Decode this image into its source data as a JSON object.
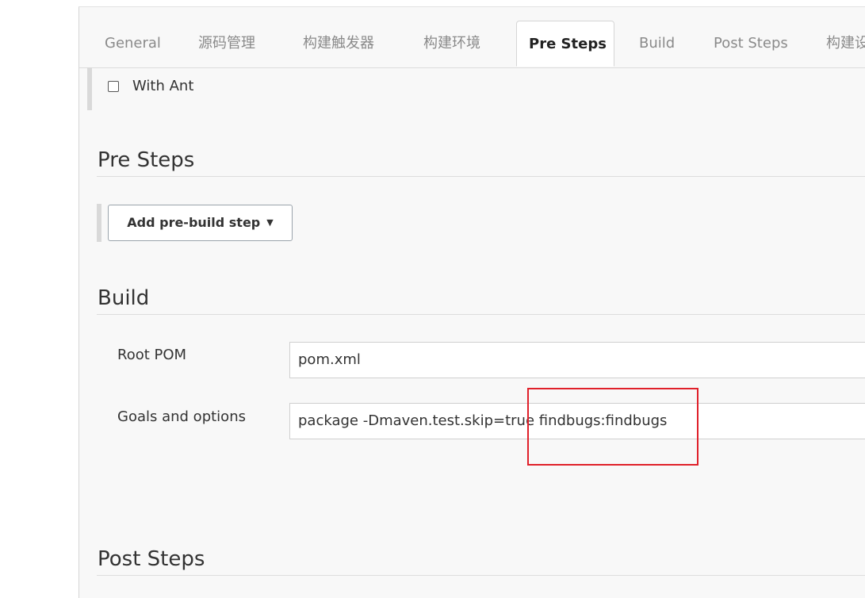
{
  "tabs": [
    {
      "label": "General",
      "active": false
    },
    {
      "label": "源码管理",
      "active": false
    },
    {
      "label": "构建触发器",
      "active": false
    },
    {
      "label": "构建环境",
      "active": false
    },
    {
      "label": "Pre Steps",
      "active": true
    },
    {
      "label": "Build",
      "active": false
    },
    {
      "label": "Post Steps",
      "active": false
    },
    {
      "label": "构建设置",
      "active": false
    }
  ],
  "with_ant": {
    "label": "With Ant",
    "checked": false
  },
  "pre_steps": {
    "title": "Pre Steps",
    "add_button_label": "Add pre-build step"
  },
  "build": {
    "title": "Build",
    "root_pom": {
      "label": "Root POM",
      "value": "pom.xml"
    },
    "goals": {
      "label": "Goals and options",
      "value": "package -Dmaven.test.skip=true findbugs:findbugs"
    }
  },
  "post_steps": {
    "title": "Post Steps"
  },
  "colors": {
    "panel_bg": "#f8f8f8",
    "highlight": "#e0202a",
    "active_tab_text": "#222222",
    "inactive_tab_text": "#8a8a8a"
  },
  "icons": {
    "dropdown": "caret-down-icon"
  }
}
